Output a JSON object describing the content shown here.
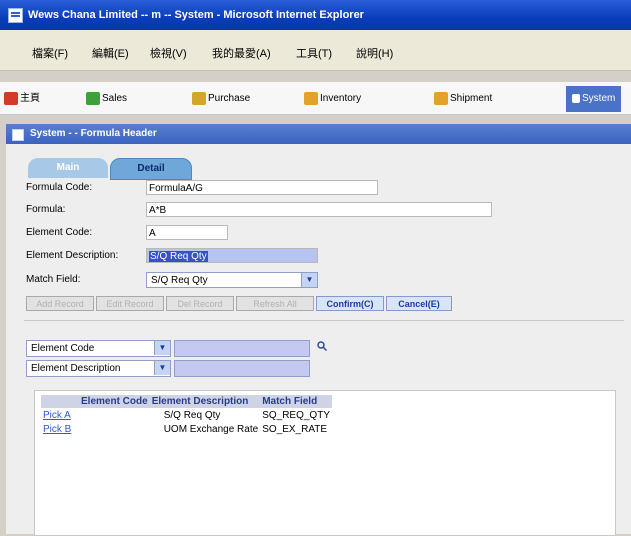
{
  "window": {
    "title": "Wews Chana Limited -- m -- System - Microsoft Internet Explorer"
  },
  "menu": [
    "檔案(F)",
    "編輯(E)",
    "檢視(V)",
    "我的最愛(A)",
    "工具(T)",
    "說明(H)"
  ],
  "nav": [
    {
      "label": "主頁",
      "icon": "home-icon",
      "color": "#d43a2a"
    },
    {
      "label": "Sales",
      "icon": "sales-icon",
      "color": "#3f9f3a"
    },
    {
      "label": "Purchase",
      "icon": "purchase-icon",
      "color": "#d3a62a"
    },
    {
      "label": "Inventory",
      "icon": "inventory-icon",
      "color": "#e3a22a"
    },
    {
      "label": "Shipment",
      "icon": "shipment-icon",
      "color": "#e3a22a"
    },
    {
      "label": "System",
      "icon": "system-icon",
      "color": "#ffffff"
    }
  ],
  "subtitle": "System - - Formula Header",
  "tabs": {
    "main": "Main",
    "detail": "Detail"
  },
  "form": {
    "formula_code_label": "Formula Code:",
    "formula_code_value": "FormulaA/G",
    "formula_label": "Formula:",
    "formula_value": "A*B",
    "element_code_label": "Element Code:",
    "element_code_value": "A",
    "element_desc_label": "Element Description:",
    "element_desc_value": "S/Q Req Qty",
    "match_field_label": "Match Field:",
    "match_field_value": "S/Q Req Qty"
  },
  "buttons": [
    "Add Record",
    "Edit Record",
    "Del Record",
    "Refresh All",
    "Confirm(C)",
    "Cancel(E)"
  ],
  "filters": [
    {
      "field": "Element Code",
      "value": ""
    },
    {
      "field": "Element Description",
      "value": ""
    }
  ],
  "table": {
    "headers": [
      "Element Code",
      "Element Description",
      "Match Field"
    ],
    "rows": [
      [
        "Pick A",
        "S/Q Req Qty",
        "SQ_REQ_QTY"
      ],
      [
        "Pick B",
        "UOM Exchange Rate",
        "SO_EX_RATE"
      ]
    ]
  },
  "colors": {
    "title_bar": "#0a3dbb",
    "active_nav": "#4a72c6",
    "tab_detail": "#6fa7d8",
    "table_header": "#cfd3e6"
  }
}
